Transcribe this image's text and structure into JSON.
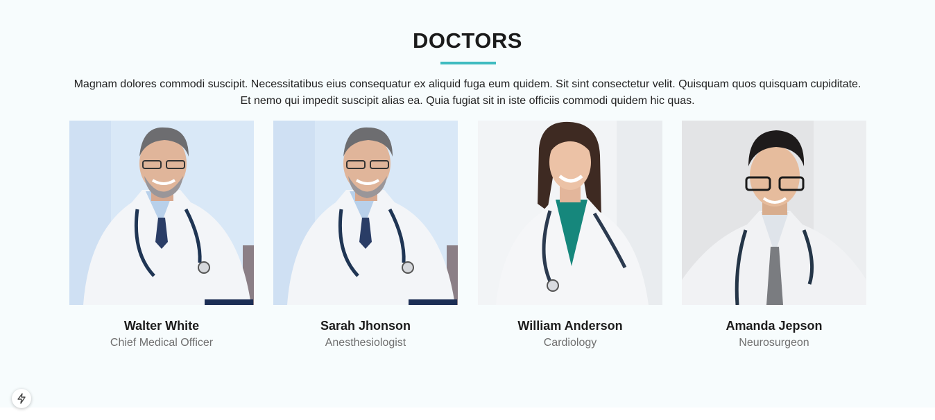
{
  "section": {
    "title": "DOCTORS",
    "intro_line1": "Magnam dolores commodi suscipit. Necessitatibus eius consequatur ex aliquid fuga eum quidem. Sit sint consectetur velit. Quisquam quos quisquam cupiditate.",
    "intro_line2": "Et nemo qui impedit suscipit alias ea. Quia fugiat sit in iste officiis commodi quidem hic quas.",
    "accent_color": "#3fbbc0"
  },
  "doctors": [
    {
      "name": "Walter White",
      "role": "Chief Medical Officer"
    },
    {
      "name": "Sarah Jhonson",
      "role": "Anesthesiologist"
    },
    {
      "name": "William Anderson",
      "role": "Cardiology"
    },
    {
      "name": "Amanda Jepson",
      "role": "Neurosurgeon"
    }
  ],
  "widgets": {
    "fab_icon": "lightning-icon"
  }
}
